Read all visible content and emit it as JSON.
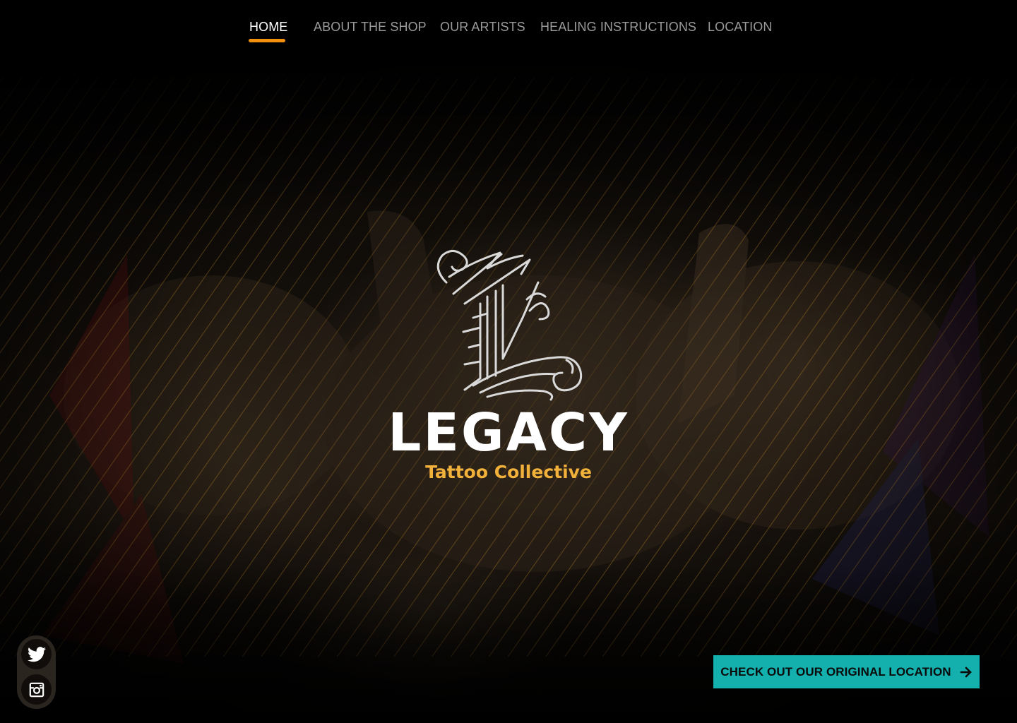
{
  "nav": {
    "items": [
      {
        "label": "HOME",
        "active": true
      },
      {
        "label": "ABOUT THE SHOP",
        "active": false
      },
      {
        "label": "OUR ARTISTS",
        "active": false
      },
      {
        "label": "HEALING INSTRUCTIONS",
        "active": false
      },
      {
        "label": "LOCATION",
        "active": false
      }
    ],
    "active_indicator_color": "#f0900c"
  },
  "brand": {
    "monogram_icon": "ornate-letter-l-icon",
    "name": "LEGACY",
    "tagline": "Tattoo Collective",
    "tagline_color": "#f2b13a"
  },
  "social": {
    "items": [
      {
        "icon": "twitter-icon"
      },
      {
        "icon": "instagram-icon"
      }
    ]
  },
  "cta": {
    "label": "CHECK OUT OUR ORIGINAL LOCATION",
    "icon": "arrow-right-icon",
    "color": "#13b0ad"
  }
}
